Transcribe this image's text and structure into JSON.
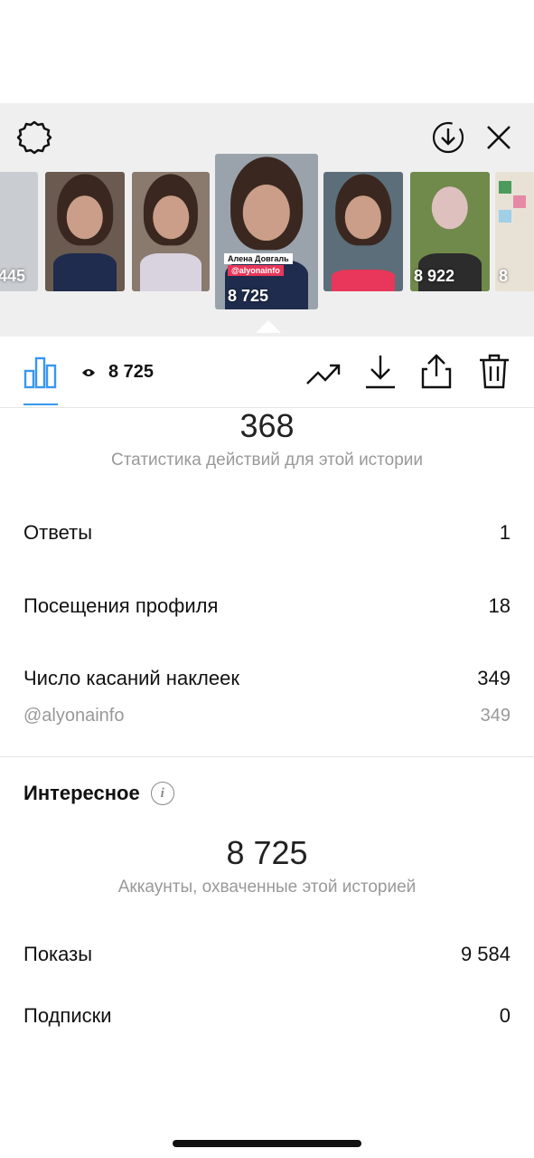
{
  "header": {
    "thumbnails": [
      {
        "views": "445",
        "bg": "#c9cdd1"
      },
      {
        "views": "",
        "bg": "#6a5a50"
      },
      {
        "views": "",
        "bg": "#8a7a6e"
      },
      {
        "views": "8 725",
        "bg": "#9aa3ab"
      },
      {
        "views": "",
        "bg": "#5c6e7a"
      },
      {
        "views": "8 922",
        "bg": "#6f8a4a"
      },
      {
        "views": "8",
        "bg": "#e8e2d6"
      }
    ],
    "active_banner_name": "Алена Довгаль",
    "active_banner_handle": "@alyonainfo"
  },
  "toolbar": {
    "views": "8 725"
  },
  "actions": {
    "count": "368",
    "label": "Статистика действий для этой истории",
    "rows": [
      {
        "label": "Ответы",
        "value": "1"
      },
      {
        "label": "Посещения профиля",
        "value": "18"
      },
      {
        "label": "Число касаний наклеек",
        "value": "349"
      }
    ],
    "sticker_sub": {
      "label": "@alyonainfo",
      "value": "349"
    }
  },
  "discovery": {
    "title": "Интересное",
    "count": "8 725",
    "label": "Аккаунты, охваченные этой историей",
    "rows": [
      {
        "label": "Показы",
        "value": "9 584"
      },
      {
        "label": "Подписки",
        "value": "0"
      }
    ]
  },
  "colors": {
    "accent": "#3897f0",
    "muted": "#999999",
    "banner": "#e8375a"
  }
}
